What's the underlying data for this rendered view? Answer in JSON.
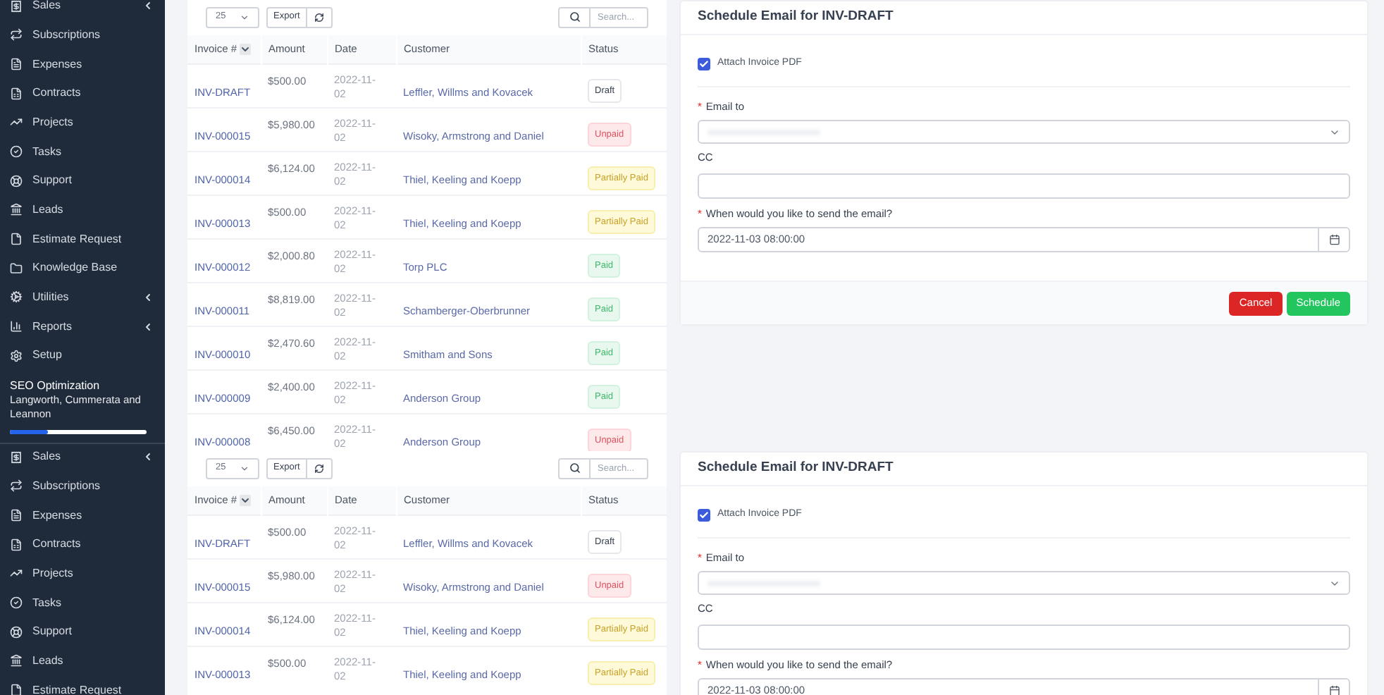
{
  "screens": [
    {
      "sidebar": {
        "items": [
          {
            "label": "Sales",
            "has_submenu": true
          },
          {
            "label": "Subscriptions",
            "has_submenu": false
          },
          {
            "label": "Expenses",
            "has_submenu": false
          },
          {
            "label": "Contracts",
            "has_submenu": false
          },
          {
            "label": "Projects",
            "has_submenu": false
          },
          {
            "label": "Tasks",
            "has_submenu": false
          },
          {
            "label": "Support",
            "has_submenu": false
          },
          {
            "label": "Leads",
            "has_submenu": false
          },
          {
            "label": "Estimate Request",
            "has_submenu": false
          },
          {
            "label": "Knowledge Base",
            "has_submenu": false
          },
          {
            "label": "Utilities",
            "has_submenu": true
          },
          {
            "label": "Reports",
            "has_submenu": true
          },
          {
            "label": "Setup",
            "has_submenu": false
          }
        ],
        "project": {
          "title": "SEO Optimization",
          "client": "Langworth, Cummerata and Leannon",
          "level": 0.28
        }
      },
      "table": {
        "page_size": "25",
        "export": "Export",
        "search_placeholder": "Search...",
        "columns": [
          "Invoice #",
          "Amount",
          "Date",
          "Customer",
          "Status"
        ],
        "rows": [
          {
            "invoice": "INV-DRAFT",
            "amount": "$500.00",
            "date": "2022-11-02",
            "customer": "Leffler, Willms and Kovacek",
            "status": {
              "label": "Draft",
              "kind": "draft"
            }
          },
          {
            "invoice": "INV-000015",
            "amount": "$5,980.00",
            "date": "2022-11-02",
            "customer": "Wisoky, Armstrong and Daniel",
            "status": {
              "label": "Unpaid",
              "kind": "unpaid"
            }
          },
          {
            "invoice": "INV-000014",
            "amount": "$6,124.00",
            "date": "2022-11-02",
            "customer": "Thiel, Keeling and Koepp",
            "status": {
              "label": "Partially Paid",
              "kind": "partial"
            }
          },
          {
            "invoice": "INV-000013",
            "amount": "$500.00",
            "date": "2022-11-02",
            "customer": "Thiel, Keeling and Koepp",
            "status": {
              "label": "Partially Paid",
              "kind": "partial"
            }
          },
          {
            "invoice": "INV-000012",
            "amount": "$2,000.80",
            "date": "2022-11-02",
            "customer": "Torp PLC",
            "status": {
              "label": "Paid",
              "kind": "paid"
            }
          },
          {
            "invoice": "INV-000011",
            "amount": "$8,819.00",
            "date": "2022-11-02",
            "customer": "Schamberger-Oberbrunner",
            "status": {
              "label": "Paid",
              "kind": "paid"
            }
          },
          {
            "invoice": "INV-000010",
            "amount": "$2,470.60",
            "date": "2022-11-02",
            "customer": "Smitham and Sons",
            "status": {
              "label": "Paid",
              "kind": "paid"
            }
          },
          {
            "invoice": "INV-000009",
            "amount": "$2,400.00",
            "date": "2022-11-02",
            "customer": "Anderson Group",
            "status": {
              "label": "Paid",
              "kind": "paid"
            }
          },
          {
            "invoice": "INV-000008",
            "amount": "$6,450.00",
            "date": "2022-11-02",
            "customer": "Anderson Group",
            "status": {
              "label": "Unpaid",
              "kind": "unpaid"
            }
          }
        ]
      },
      "form": {
        "title": "Schedule Email for INV-DRAFT",
        "attach": {
          "label": "Attach Invoice PDF",
          "checked": true
        },
        "fields": [
          {
            "kind": "select",
            "label": "Email to",
            "required_mark": "*"
          },
          {
            "kind": "text",
            "label": "CC"
          },
          {
            "kind": "date",
            "label": "When would you like to send the email?",
            "required_mark": "*",
            "value": "2022-11-03 08:00:00"
          }
        ],
        "buttons": [
          {
            "label": "Cancel",
            "kind": "danger"
          },
          {
            "label": "Schedule",
            "kind": "success"
          }
        ]
      }
    },
    {
      "sidebar": {
        "items": [
          {
            "label": "Sales",
            "has_submenu": true
          },
          {
            "label": "Subscriptions",
            "has_submenu": false
          },
          {
            "label": "Expenses",
            "has_submenu": false
          },
          {
            "label": "Contracts",
            "has_submenu": false
          },
          {
            "label": "Projects",
            "has_submenu": false
          },
          {
            "label": "Tasks",
            "has_submenu": false
          },
          {
            "label": "Support",
            "has_submenu": false
          },
          {
            "label": "Leads",
            "has_submenu": false
          },
          {
            "label": "Estimate Request",
            "has_submenu": false
          }
        ]
      },
      "table": {
        "page_size": "25",
        "export": "Export",
        "search_placeholder": "Search...",
        "columns": [
          "Invoice #",
          "Amount",
          "Date",
          "Customer",
          "Status"
        ],
        "rows": [
          {
            "invoice": "INV-DRAFT",
            "amount": "$500.00",
            "date": "2022-11-02",
            "customer": "Leffler, Willms and Kovacek",
            "status": {
              "label": "Draft",
              "kind": "draft"
            }
          },
          {
            "invoice": "INV-000015",
            "amount": "$5,980.00",
            "date": "2022-11-02",
            "customer": "Wisoky, Armstrong and Daniel",
            "status": {
              "label": "Unpaid",
              "kind": "unpaid"
            }
          },
          {
            "invoice": "INV-000014",
            "amount": "$6,124.00",
            "date": "2022-11-02",
            "customer": "Thiel, Keeling and Koepp",
            "status": {
              "label": "Partially Paid",
              "kind": "partial"
            }
          },
          {
            "invoice": "INV-000013",
            "amount": "$500.00",
            "date": "2022-11-02",
            "customer": "Thiel, Keeling and Koepp",
            "status": {
              "label": "Partially Paid",
              "kind": "partial"
            }
          }
        ]
      },
      "form": {
        "title": "Schedule Email for INV-DRAFT",
        "attach": {
          "label": "Attach Invoice PDF",
          "checked": true
        },
        "fields": [
          {
            "kind": "select",
            "label": "Email to",
            "required_mark": "*"
          },
          {
            "kind": "text",
            "label": "CC"
          },
          {
            "kind": "date",
            "label": "When would you like to send the email?",
            "required_mark": "*",
            "value": "2022-11-03 08:00:00"
          }
        ]
      }
    }
  ]
}
